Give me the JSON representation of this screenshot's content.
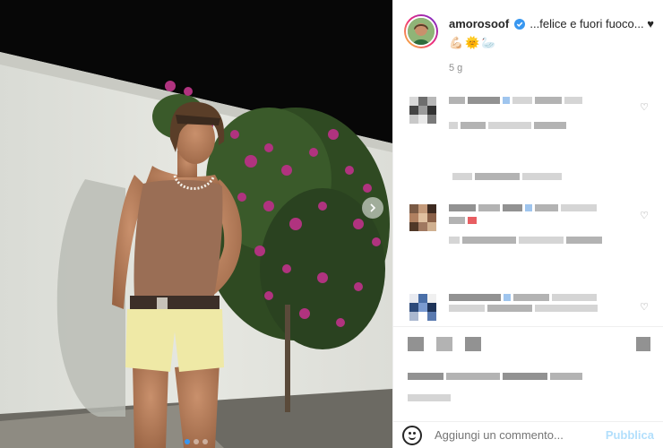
{
  "post": {
    "username": "amorosoof",
    "caption": "...felice e fuori fuoco... ♥",
    "caption_emojis": "💪🏻🌞🦢",
    "time_ago": "5 g"
  },
  "photo": {
    "carousel_count": 3,
    "active_index": 0
  },
  "comment_box": {
    "placeholder": "Aggiungi un commento...",
    "publish_label": "Pubblica"
  },
  "icons": {
    "verified": "verified-badge-icon",
    "next": "chevron-right-icon",
    "emoji": "emoji-smiley-icon",
    "heart": "heart-icon"
  },
  "colors": {
    "verified_blue": "#3897f0",
    "publish_disabled": "#b2dffc",
    "muted_text": "#8e8e8e"
  }
}
